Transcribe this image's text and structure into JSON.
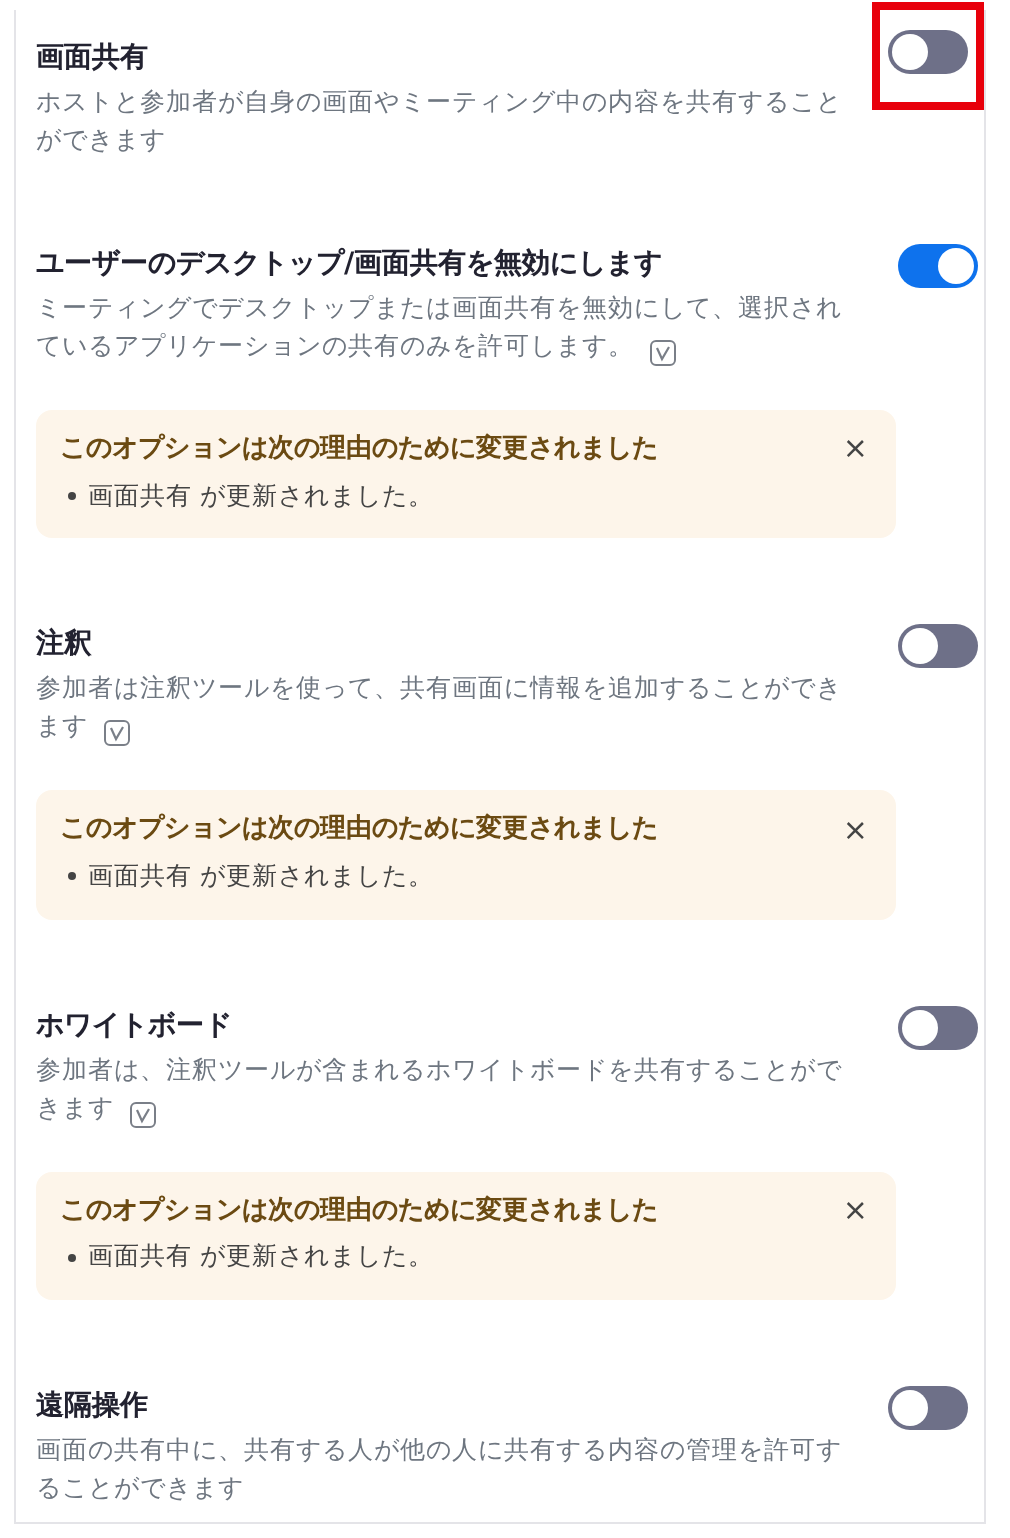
{
  "settings": [
    {
      "title": "画面共有",
      "description": "ホストと参加者が自身の画面やミーティング中の内容を共有することができます",
      "version_icon": false,
      "on": false,
      "highlighted": true
    },
    {
      "title": "ユーザーのデスクトップ/画面共有を無効にします",
      "description": "ミーティングでデスクトップまたは画面共有を無効にして、選択されているアプリケーションの共有のみを許可します。",
      "version_icon": true,
      "on": true,
      "highlighted": false,
      "notice": {
        "title": "このオプションは次の理由のために変更されました",
        "close": "×",
        "items": [
          "画面共有 が更新されました。"
        ]
      }
    },
    {
      "title": "注釈",
      "description": "参加者は注釈ツールを使って、共有画面に情報を追加することができます",
      "version_icon": true,
      "on": false,
      "highlighted": false,
      "notice": {
        "title": "このオプションは次の理由のために変更されました",
        "close": "×",
        "items": [
          "画面共有 が更新されました。"
        ]
      }
    },
    {
      "title": "ホワイトボード",
      "description": "参加者は、注釈ツールが含まれるホワイトボードを共有することができます",
      "version_icon": true,
      "on": false,
      "highlighted": false,
      "notice": {
        "title": "このオプションは次の理由のために変更されました",
        "close": "×",
        "items": [
          "画面共有 が更新されました。"
        ]
      }
    },
    {
      "title": "遠隔操作",
      "description": "画面の共有中に、共有する人が他の人に共有する内容の管理を許可することができます",
      "version_icon": false,
      "on": false,
      "highlighted": false
    }
  ]
}
